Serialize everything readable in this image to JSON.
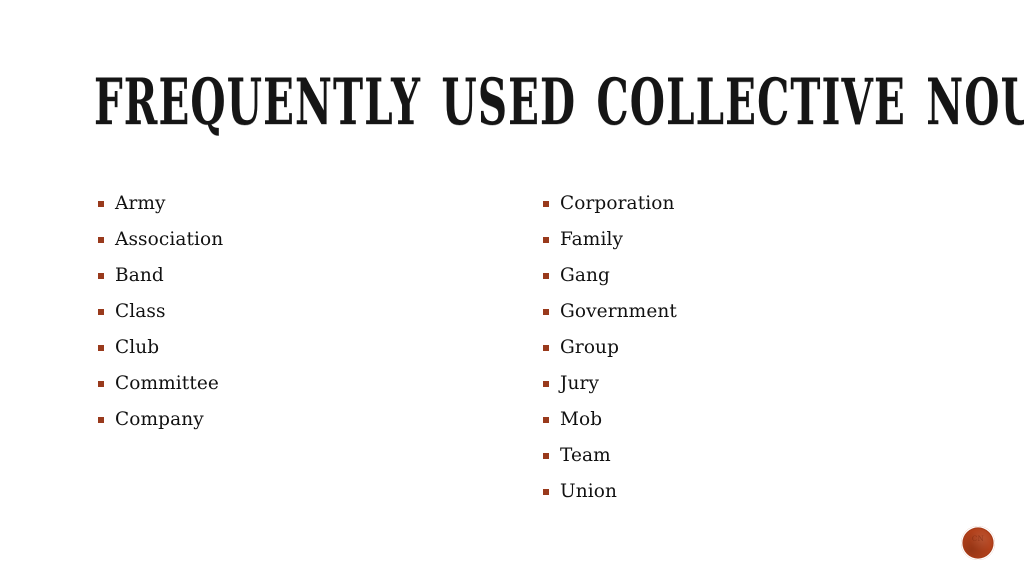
{
  "slide": {
    "title": "Frequently used collective nouns",
    "background_color": "#ffffff",
    "title_color": "#151515",
    "bullet_color": "#993a1c",
    "text_color": "#111111",
    "accent_color": "#b2401a"
  },
  "content": {
    "left_column": [
      {
        "label": "Army"
      },
      {
        "label": "Association"
      },
      {
        "label": "Band"
      },
      {
        "label": "Class"
      },
      {
        "label": "Club"
      },
      {
        "label": "Committee"
      },
      {
        "label": "Company"
      }
    ],
    "right_column": [
      {
        "label": "Corporation"
      },
      {
        "label": "Family"
      },
      {
        "label": "Gang"
      },
      {
        "label": "Government"
      },
      {
        "label": "Group"
      },
      {
        "label": "Jury"
      },
      {
        "label": "Mob"
      },
      {
        "label": "Team"
      },
      {
        "label": "Union"
      }
    ]
  },
  "decoration": {
    "badge_glyph": "CN"
  }
}
